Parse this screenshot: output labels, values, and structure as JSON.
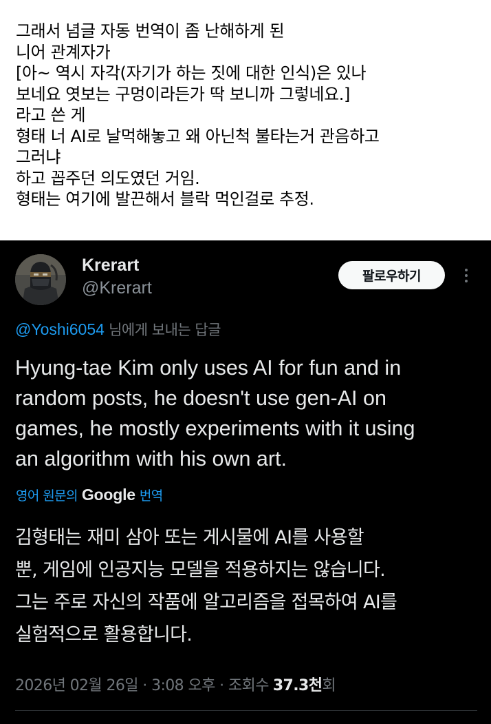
{
  "caption": {
    "lines": [
      "그래서 념글 자동 번역이 좀 난해하게 된",
      "니어 관계자가",
      "[아~ 역시 자각(자기가 하는 짓에 대한 인식)은 있나",
      "보네요 엿보는 구멍이라든가 딱 보니까 그렇네요.]",
      "라고 쓴 게",
      "형태 너 AI로 날먹해놓고 왜 아닌척 불타는거 관음하고",
      "그러냐",
      "하고 꼽주던 의도였던 거임.",
      "형태는 여기에 발끈해서 블락 먹인걸로 추정."
    ]
  },
  "tweet": {
    "avatar_icon": "avatar-ninja-icon",
    "display_name": "Krerart",
    "handle": "@Krerart",
    "follow_label": "팔로우하기",
    "more_icon": "more-vertical-icon",
    "reply_mention": "@Yoshi6054",
    "reply_suffix": " 님에게 보내는 답글",
    "text_lines": [
      "Hyung-tae Kim only uses AI for fun and in",
      "random posts, he doesn't use gen-AI on",
      "games, he mostly experiments with it using",
      "an algorithm with his own art."
    ],
    "translate_prefix": "영어 원문의",
    "translate_brand": "Google",
    "translate_suffix": "번역",
    "translated_lines": [
      "김형태는 재미 삼아 또는 게시물에 AI를 사용할",
      "뿐, 게임에 인공지능 모델을 적용하지는 않습니다.",
      "그는 주로 자신의 작품에 알고리즘을 접목하여 AI를",
      "실험적으로 활용합니다."
    ],
    "timestamp": "2026년 02월 26일 · 3:08 오후 · 조회수",
    "views_count": "37.3천",
    "views_unit": "회"
  },
  "colors": {
    "background": "#000000",
    "text_primary": "#e7e9ea",
    "text_secondary": "#71767b",
    "accent_blue": "#1d9bf0"
  }
}
